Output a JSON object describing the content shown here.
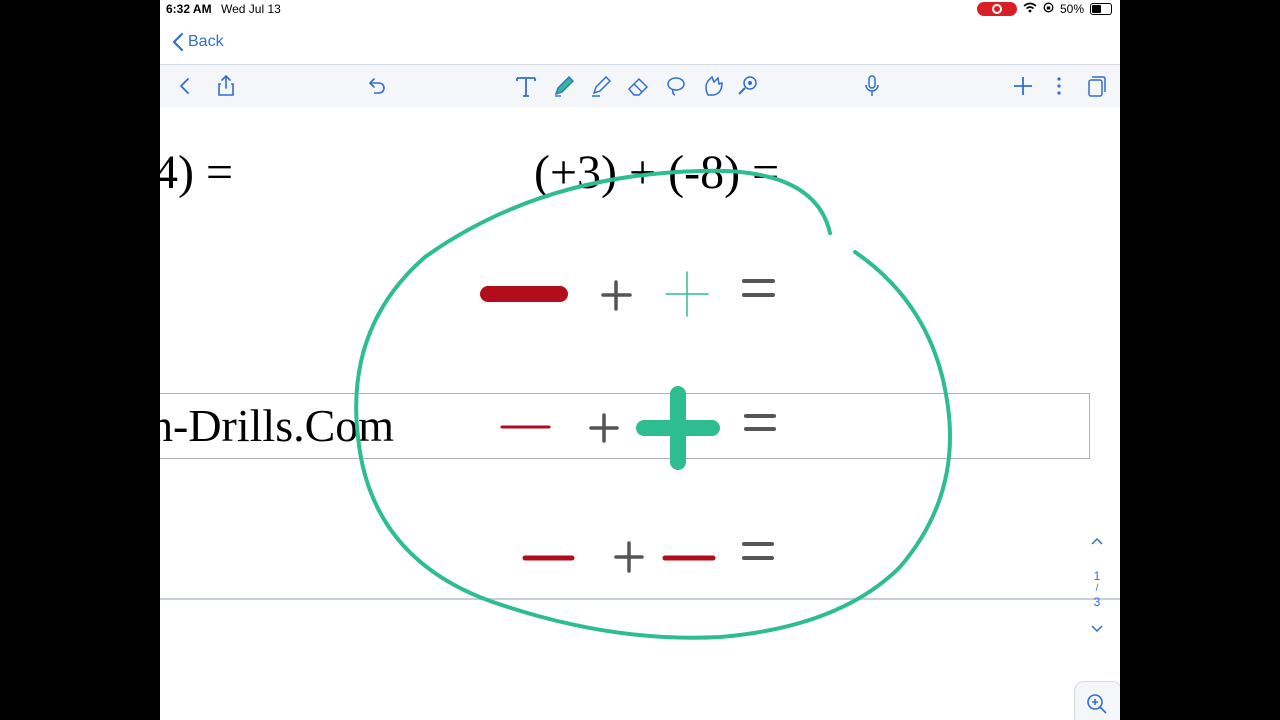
{
  "status": {
    "time": "6:32 AM",
    "date": "Wed Jul 13",
    "battery": "50%"
  },
  "nav": {
    "back_label": "Back"
  },
  "toolbar": {
    "items": [
      "chevron-left-icon",
      "share-icon",
      "undo-icon",
      "text-tool-icon",
      "pen-tool-icon",
      "highlighter-icon",
      "eraser-icon",
      "lasso-icon",
      "shapes-icon",
      "laser-pointer-icon",
      "microphone-icon",
      "add-icon",
      "more-icon",
      "pages-icon"
    ],
    "active": "pen-tool-icon"
  },
  "document": {
    "equation_left": "4) =",
    "equation_right": "(+3) + (-8) =",
    "banner_text": "h-Drills.Com"
  },
  "pager": {
    "current": "1",
    "separator": "/",
    "total": "3"
  },
  "colors": {
    "accent": "#2f6fd0",
    "ink_green": "#2dbd90",
    "ink_red": "#b10d1a",
    "ink_gray": "#555555"
  }
}
